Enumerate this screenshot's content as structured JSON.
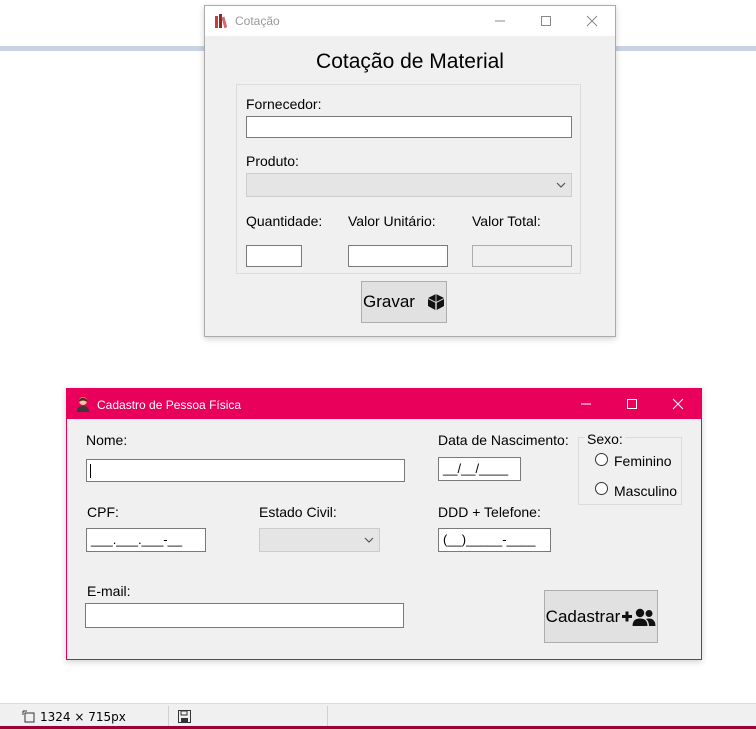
{
  "colors": {
    "accent": "#e8005b",
    "window_bg": "#f0f0f0"
  },
  "cotacao": {
    "window_title": "Cotação",
    "heading": "Cotação de Material",
    "fornecedor_label": "Fornecedor:",
    "fornecedor_value": "",
    "produto_label": "Produto:",
    "produto_value": "",
    "quantidade_label": "Quantidade:",
    "quantidade_value": "",
    "valor_unitario_label": "Valor Unitário:",
    "valor_unitario_value": "",
    "valor_total_label": "Valor Total:",
    "valor_total_value": "",
    "gravar_label": "Gravar",
    "gravar_icon": "box-icon"
  },
  "cadastro": {
    "window_title": "Cadastro de Pessoa Física",
    "nome_label": "Nome:",
    "nome_value": "",
    "data_nascimento_label": "Data de Nascimento:",
    "data_nascimento_mask": "__/__/____",
    "sexo_label": "Sexo:",
    "sexo_options": [
      "Feminino",
      "Masculino"
    ],
    "cpf_label": "CPF:",
    "cpf_mask": "___.___.___-__",
    "estado_civil_label": "Estado Civil:",
    "estado_civil_value": "",
    "telefone_label": "DDD + Telefone:",
    "telefone_mask": "(__)_____-____",
    "email_label": "E-mail:",
    "email_value": "",
    "cadastrar_label": "Cadastrar",
    "cadastrar_icon": "user-add-icon"
  },
  "statusbar": {
    "dimensions": "1324 × 715px"
  }
}
